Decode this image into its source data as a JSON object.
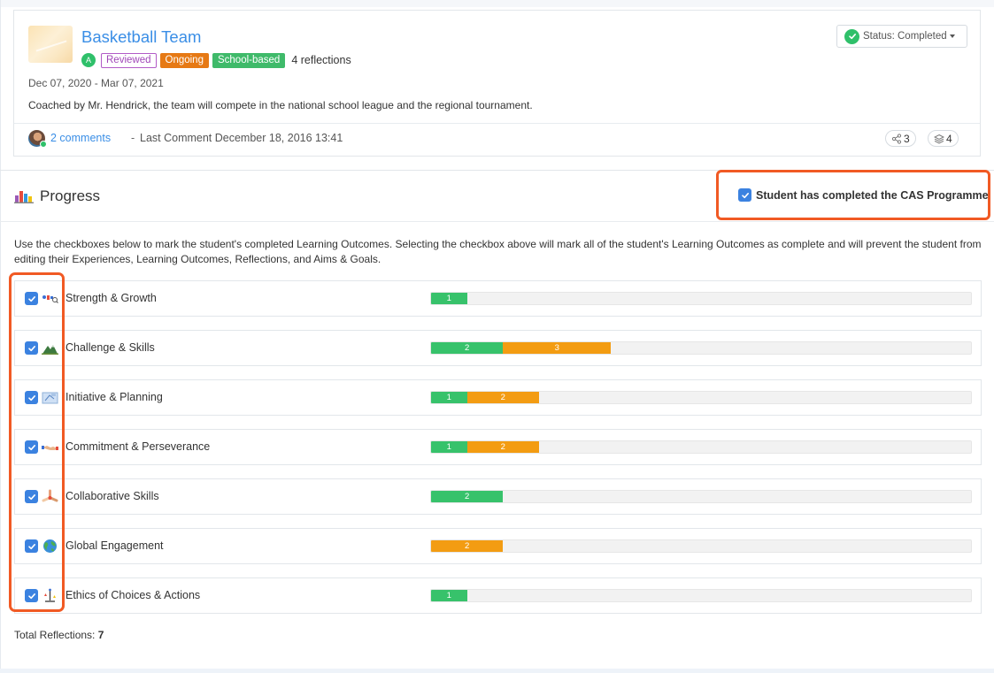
{
  "experience": {
    "title": "Basketball Team",
    "avatar_initial": "A",
    "tags": {
      "reviewed": "Reviewed",
      "ongoing": "Ongoing",
      "school_based": "School-based"
    },
    "reflections": "4 reflections",
    "dates": "Dec 07, 2020 - Mar 07, 2021",
    "description": "Coached by Mr. Hendrick, the team will compete in the national school league and the regional tournament.",
    "comments_link": "2 comments",
    "separator": "-",
    "last_comment": "Last Comment December 18, 2016 13:41",
    "share_count": "3",
    "layers_count": "4",
    "status_label": "Status: Completed"
  },
  "progress": {
    "title": "Progress",
    "cas_label": "Student has completed the CAS Programme",
    "cas_checked": true,
    "intro": "Use the checkboxes below to mark the student's completed Learning Outcomes. Selecting the checkbox above will mark all of the student's Learning Outcomes as complete and will prevent the student from editing their Experiences, Learning Outcomes, Reflections, and Aims & Goals.",
    "bar_max": 15,
    "outcomes": [
      {
        "label": "Strength & Growth",
        "icon": "strength-growth-icon",
        "checked": true,
        "green": 1,
        "orange": 0
      },
      {
        "label": "Challenge & Skills",
        "icon": "mountain-icon",
        "checked": true,
        "green": 2,
        "orange": 3
      },
      {
        "label": "Initiative & Planning",
        "icon": "blueprint-icon",
        "checked": true,
        "green": 1,
        "orange": 2
      },
      {
        "label": "Commitment & Perseverance",
        "icon": "handshake-icon",
        "checked": true,
        "green": 1,
        "orange": 2
      },
      {
        "label": "Collaborative Skills",
        "icon": "collaboration-icon",
        "checked": true,
        "green": 2,
        "orange": 0
      },
      {
        "label": "Global Engagement",
        "icon": "globe-icon",
        "checked": true,
        "green": 0,
        "orange": 2
      },
      {
        "label": "Ethics of Choices & Actions",
        "icon": "scales-icon",
        "checked": true,
        "green": 1,
        "orange": 0
      }
    ],
    "total_label": "Total Reflections:",
    "total_value": "7"
  },
  "colors": {
    "link": "#3a8ee6",
    "green": "#37c26b",
    "orange": "#f39c12",
    "highlight": "#f15a24",
    "checkbox": "#3b82e0"
  }
}
